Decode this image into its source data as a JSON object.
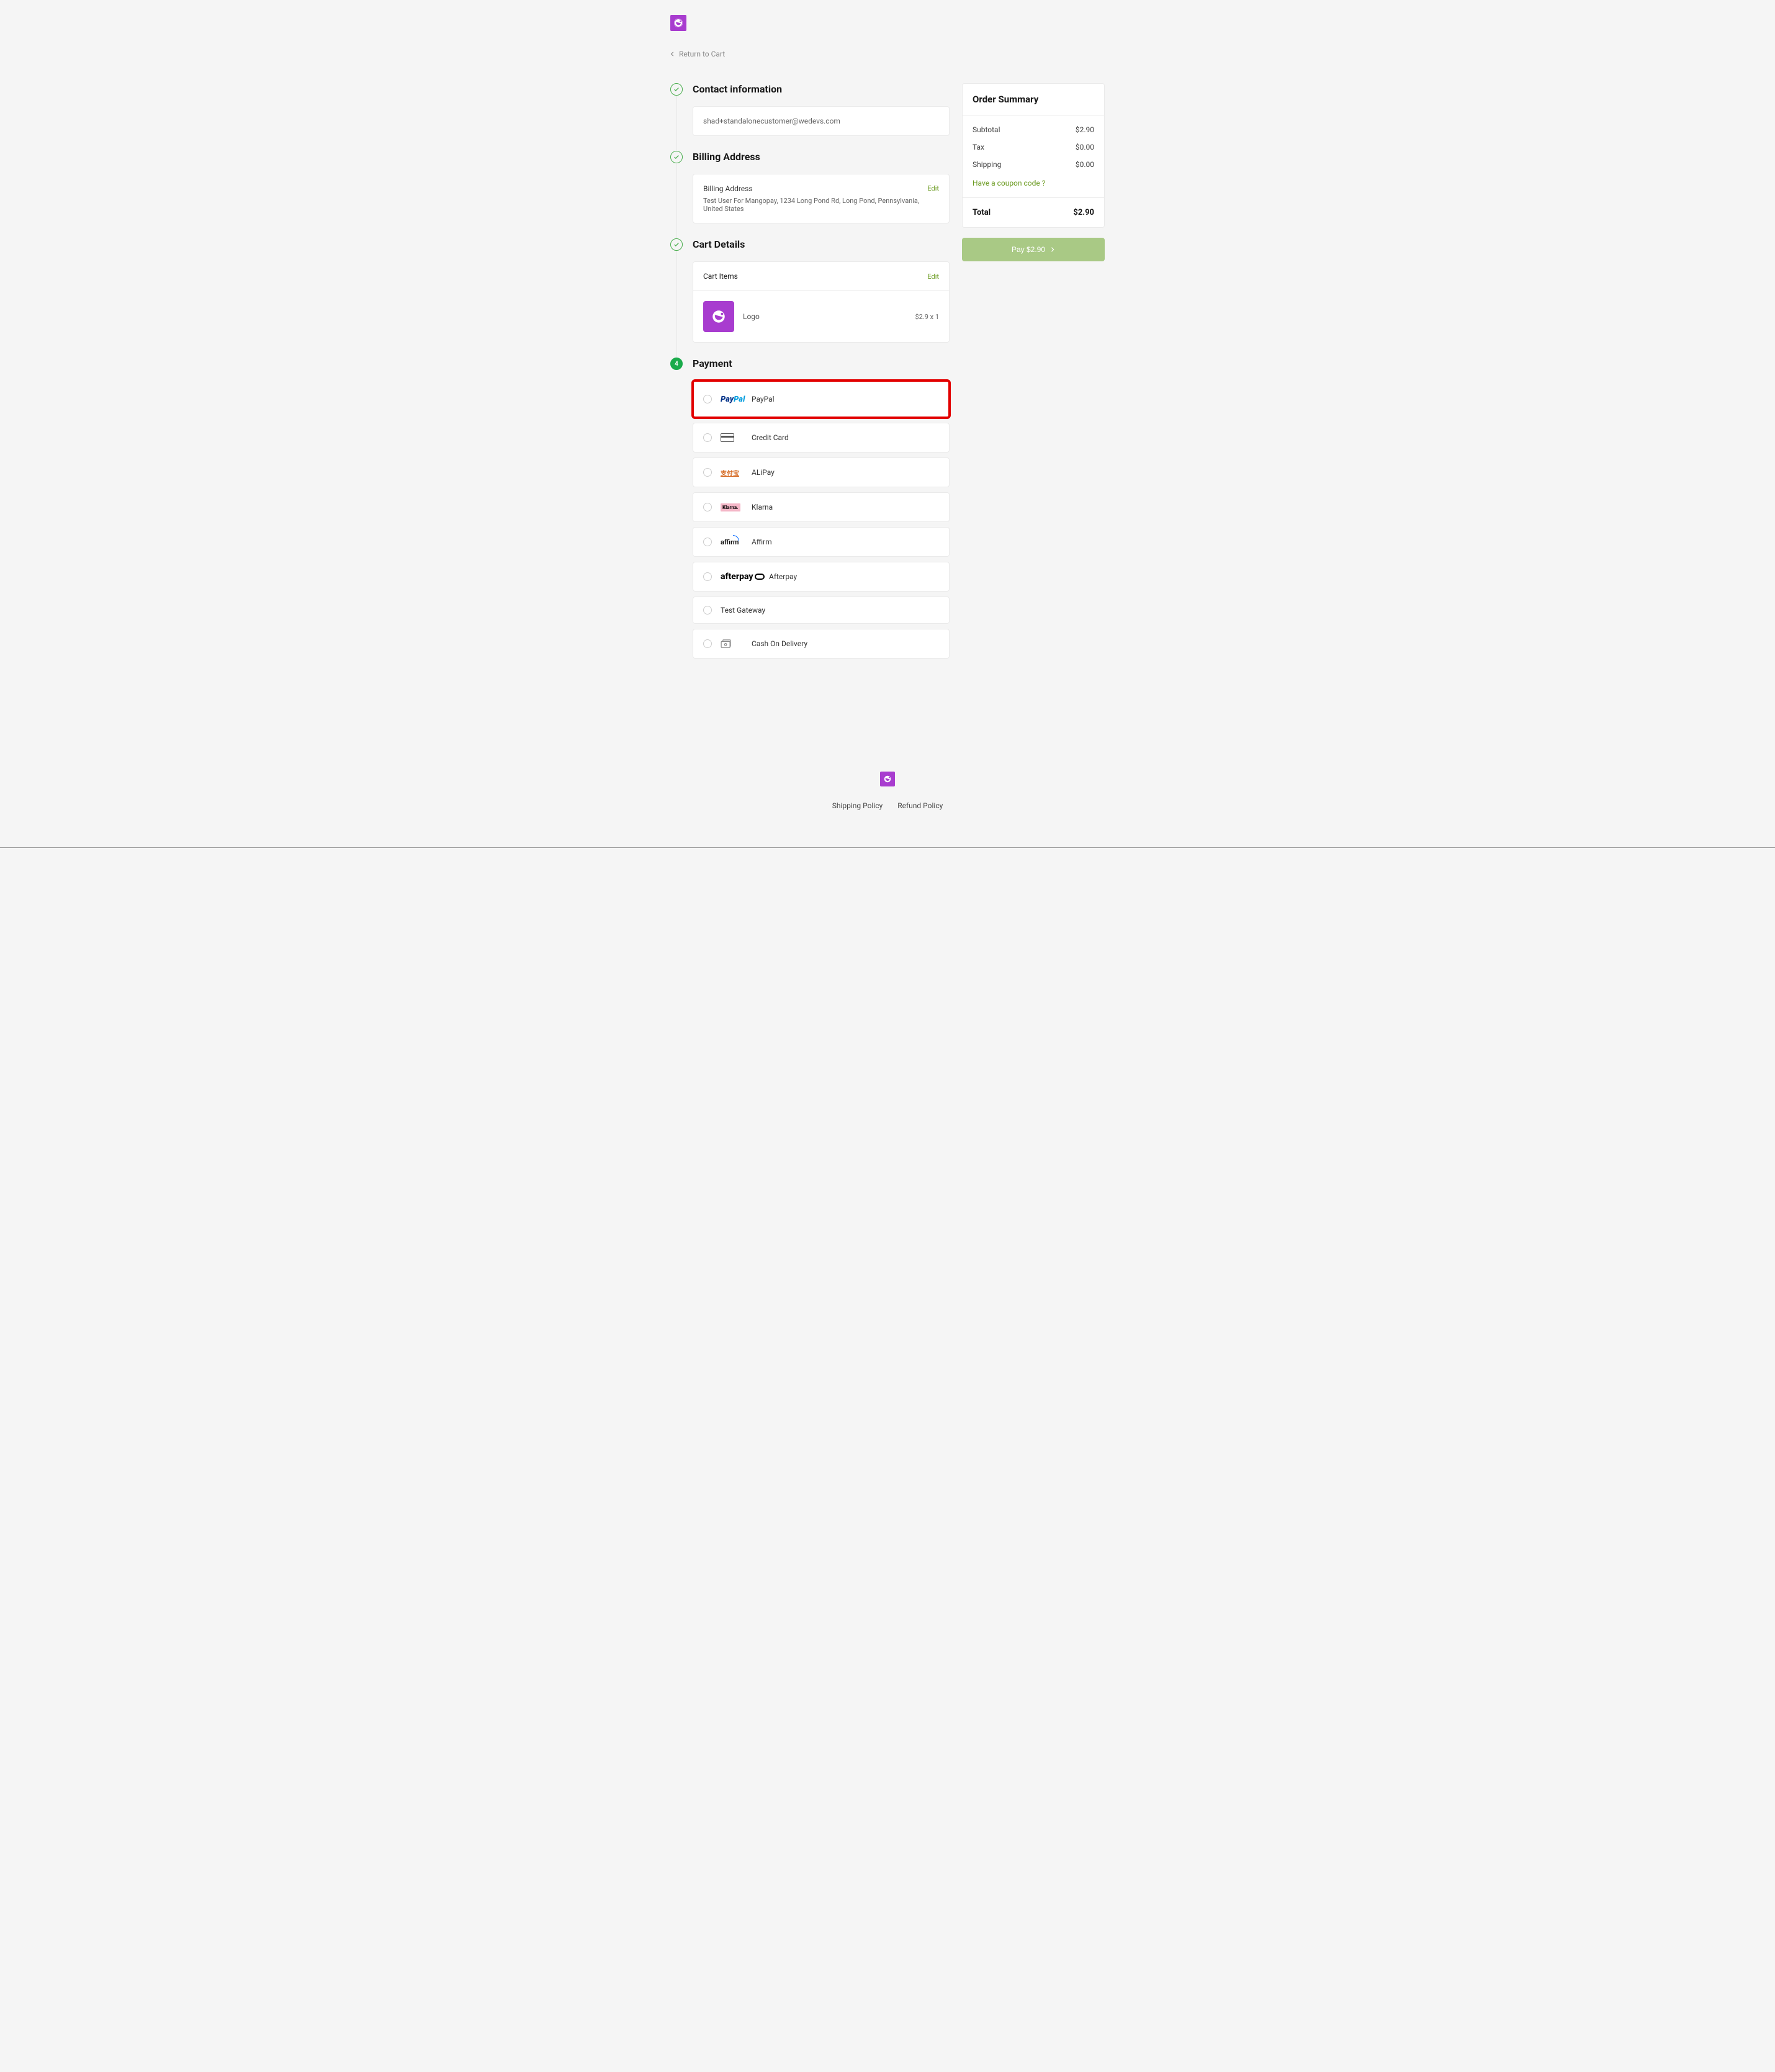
{
  "header": {
    "return_label": "Return to Cart"
  },
  "steps": {
    "contact": {
      "title": "Contact information",
      "email": "shad+standalonecustomer@wedevs.com"
    },
    "billing": {
      "title": "Billing Address",
      "label": "Billing Address",
      "details": "Test User For Mangopay, 1234 Long Pond Rd, Long Pond, Pennsylvania, United States",
      "edit": "Edit"
    },
    "cart": {
      "title": "Cart Details",
      "items_label": "Cart Items",
      "edit": "Edit",
      "item": {
        "name": "Logo",
        "price_qty": "$2.9 x 1"
      }
    },
    "payment": {
      "number": "4",
      "title": "Payment",
      "options": {
        "paypal": "PayPal",
        "credit_card": "Credit Card",
        "alipay": "ALiPay",
        "klarna": "Klarna",
        "affirm": "Affirm",
        "afterpay": "Afterpay",
        "test_gateway": "Test Gateway",
        "cod": "Cash On Delivery"
      }
    }
  },
  "summary": {
    "title": "Order Summary",
    "subtotal_label": "Subtotal",
    "subtotal_value": "$2.90",
    "tax_label": "Tax",
    "tax_value": "$0.00",
    "shipping_label": "Shipping",
    "shipping_value": "$0.00",
    "coupon_link": "Have a coupon code ?",
    "total_label": "Total",
    "total_value": "$2.90",
    "pay_button": "Pay $2.90"
  },
  "footer": {
    "shipping_policy": "Shipping Policy",
    "refund_policy": "Refund Policy"
  },
  "icons": {
    "paypal_brand": "PayPal",
    "alipay_brand": "支付宝",
    "klarna_brand": "Klarna.",
    "affirm_brand": "affirm",
    "afterpay_brand": "afterpay"
  }
}
